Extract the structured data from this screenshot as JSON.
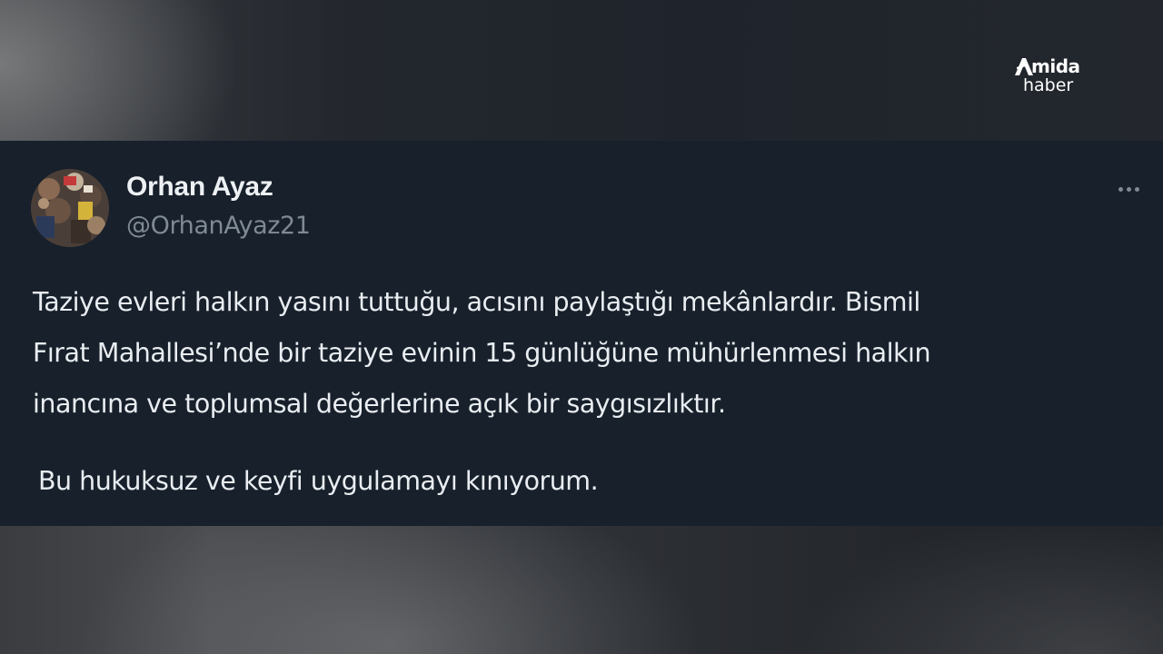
{
  "watermark": {
    "brand": "Amida",
    "sub": "haber",
    "brand_initial": "A",
    "brand_rest": "mida"
  },
  "tweet": {
    "author_name": "Orhan Ayaz",
    "author_handle": "@OrhanAyaz21",
    "avatar_icon": "profile-photo",
    "more_icon": "more-options-icon",
    "lines": [
      "Taziye evleri halkın yasını tuttuğu, acısını paylaştığı mekânlardır. Bismil",
      "Fırat Mahallesi’nde bir taziye evinin 15 günlüğüne mühürlenmesi halkın",
      "inancına ve toplumsal değerlerine açık bir saygısızlıktır."
    ],
    "paragraph_2": "Bu hukuksuz ve keyfi uygulamayı kınıyorum."
  },
  "colors": {
    "tweet_background": "#17202b",
    "text_primary": "#e9edf1",
    "text_secondary": "#7f8a95"
  }
}
